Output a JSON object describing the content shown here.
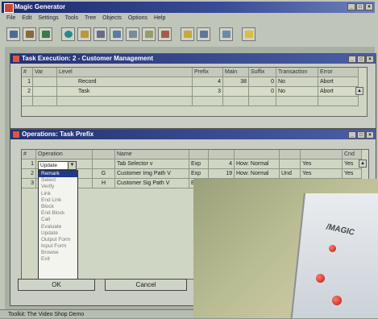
{
  "app": {
    "title": "Magic Generator",
    "menu": [
      "File",
      "Edit",
      "Settings",
      "Tools",
      "Tree",
      "Objects",
      "Options",
      "Help"
    ]
  },
  "task_window": {
    "title": "Task Execution: 2 - Customer Management",
    "columns": [
      "#",
      "Var",
      "Level",
      "Prefix",
      "Main",
      "Suffix",
      "Transaction",
      "Error"
    ],
    "rows": [
      {
        "num": "1",
        "var": "",
        "level": "Record",
        "prefix": "4",
        "main": "38",
        "suffix": "0",
        "transaction": "No",
        "error": "Abort"
      },
      {
        "num": "2",
        "var": "",
        "level": "Task",
        "prefix": "3",
        "main": "",
        "suffix": "0",
        "transaction": "No",
        "error": "Abort"
      }
    ]
  },
  "ops_window": {
    "title": "Operations: Task Prefix",
    "columns": [
      "#",
      "Operation",
      "",
      "Name",
      "",
      "",
      "",
      "",
      "",
      "Cnd"
    ],
    "rows": [
      {
        "num": "1",
        "op": "Update",
        "col": "",
        "name": "Tab Selector v",
        "type": "Exp",
        "val": "4",
        "how": "How: Normal",
        "und": "",
        "yes": "Yes",
        "cnd": "Yes"
      },
      {
        "num": "2",
        "op": "",
        "col": "G",
        "name": "Customer Img Path V",
        "type": "Exp",
        "val": "19",
        "how": "How: Normal",
        "und": "Und",
        "yes": "Yes",
        "cnd": "Yes"
      },
      {
        "num": "3",
        "op": "",
        "col": "H",
        "name": "Customer Sig Path V",
        "type": "Exp",
        "val": "",
        "how": "",
        "und": "",
        "yes": "",
        "cnd": ""
      }
    ],
    "dropdown_value": "Update",
    "dropdown_options": [
      "Remark",
      "Select",
      "Verify",
      "Link",
      "End Link",
      "Block",
      "End Block",
      "Call",
      "Evaluate",
      "Update",
      "Output Form",
      "Input Form",
      "Browse",
      "Exit"
    ],
    "ok_label": "OK",
    "cancel_label": "Cancel"
  },
  "status": {
    "text": "Toolkit: The Video Shop Demo"
  },
  "photo": {
    "product_label": "MAGIC"
  }
}
